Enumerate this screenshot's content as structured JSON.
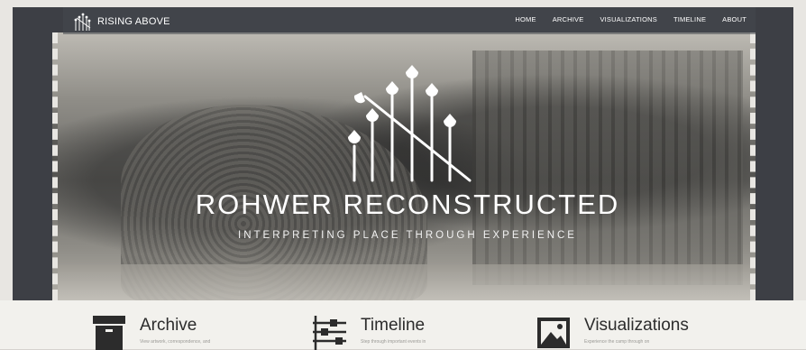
{
  "brand": {
    "name": "RISING ABOVE"
  },
  "nav": {
    "items": [
      "HOME",
      "ARCHIVE",
      "VISUALIZATIONS",
      "TIMELINE",
      "ABOUT"
    ]
  },
  "hero": {
    "title": "ROHWER RECONSTRUCTED",
    "subtitle": "INTERPRETING PLACE THROUGH EXPERIENCE"
  },
  "features": [
    {
      "title": "Archive",
      "icon": "archive-box-icon",
      "desc": "View artwork, correspondence, and"
    },
    {
      "title": "Timeline",
      "icon": "timeline-icon",
      "desc": "Step through important events in"
    },
    {
      "title": "Visualizations",
      "icon": "image-icon",
      "desc": "Experience the camp through on"
    }
  ],
  "colors": {
    "frame": "#3d3f45",
    "feature_bg": "#f2f1ed",
    "text_dark": "#2c2c2c"
  }
}
